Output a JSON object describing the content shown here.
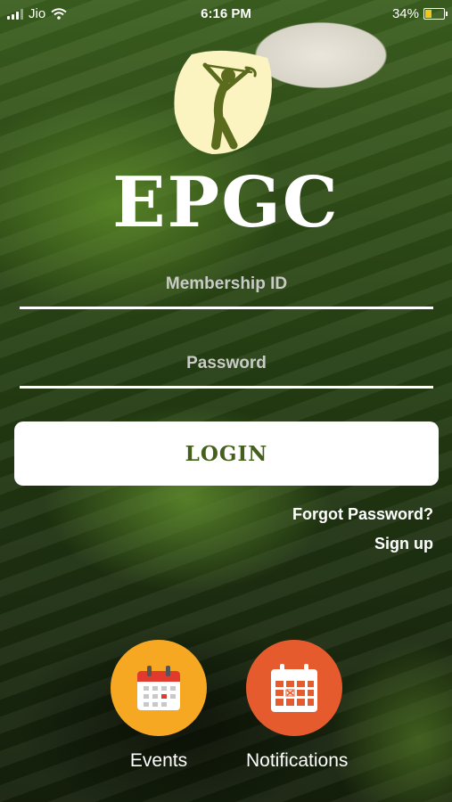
{
  "status_bar": {
    "carrier": "Jio",
    "time": "6:16 PM",
    "battery": "34%",
    "battery_color": "#f5c518"
  },
  "brand": {
    "name": "EPGC",
    "logo_icon": "golfer-icon",
    "logo_color": "#fbf3c0"
  },
  "form": {
    "membership_placeholder": "Membership ID",
    "password_placeholder": "Password",
    "login_label": "LOGIN",
    "login_color": "#44601c"
  },
  "links": {
    "forgot_password": "Forgot Password?",
    "sign_up": "Sign up"
  },
  "tiles": [
    {
      "label": "Events",
      "icon": "calendar-icon",
      "color": "#f7a823"
    },
    {
      "label": "Notifications",
      "icon": "calendar-cancel-icon",
      "color": "#e55b2d"
    }
  ]
}
